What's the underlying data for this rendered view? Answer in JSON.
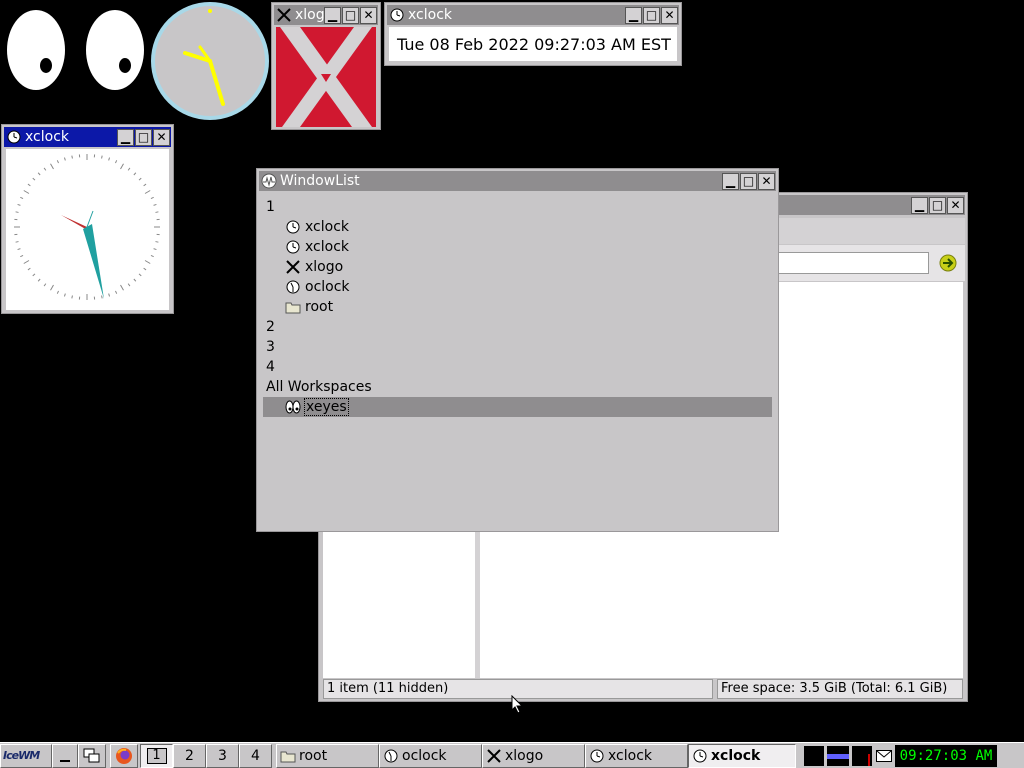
{
  "colors": {
    "desktop": "#000000",
    "active_title": "#0c18a8",
    "inactive_title": "#8f8d8f",
    "clock_face": "#c8c6c8",
    "clock_hands": "#ffff00",
    "xlogo_red": "#d01830"
  },
  "xeyes": {
    "name": "xeyes"
  },
  "xclock_small": {
    "title": "xclock",
    "time_text": "Tue 08 Feb 2022 09:27:03 AM EST"
  },
  "xlogo_window": {
    "title": "xlogo"
  },
  "xclock_analog": {
    "title": "xclock"
  },
  "windowlist": {
    "title": "WindowList",
    "rows": [
      {
        "label": "1",
        "icon": "",
        "level": 0
      },
      {
        "label": "xclock",
        "icon": "clock-icon",
        "level": 1
      },
      {
        "label": "xclock",
        "icon": "clock-icon",
        "level": 1
      },
      {
        "label": "xlogo",
        "icon": "x-logo-icon",
        "level": 1
      },
      {
        "label": "oclock",
        "icon": "oclock-icon",
        "level": 1
      },
      {
        "label": "root",
        "icon": "folder-icon",
        "level": 1
      },
      {
        "label": "2",
        "icon": "",
        "level": 0
      },
      {
        "label": "3",
        "icon": "",
        "level": 0
      },
      {
        "label": "4",
        "icon": "",
        "level": 0
      },
      {
        "label": "All Workspaces",
        "icon": "",
        "level": 0
      },
      {
        "label": "xeyes",
        "icon": "eyes-icon",
        "level": 1,
        "selected": true
      }
    ]
  },
  "filemanager": {
    "status_left": "1 item (11 hidden)",
    "status_right": "Free space: 3.5 GiB (Total: 6.1 GiB)"
  },
  "taskbar": {
    "start_label": "IceWM",
    "workspaces": [
      "1",
      "2",
      "3",
      "4"
    ],
    "active_workspace": "1",
    "tasks": [
      {
        "label": "root",
        "icon": "folder-icon"
      },
      {
        "label": "oclock",
        "icon": "oclock-icon"
      },
      {
        "label": "xlogo",
        "icon": "x-logo-icon"
      },
      {
        "label": "xclock",
        "icon": "clock-icon"
      },
      {
        "label": "xclock",
        "icon": "clock-icon",
        "active": true
      }
    ],
    "clock": "09:27:03 AM"
  }
}
